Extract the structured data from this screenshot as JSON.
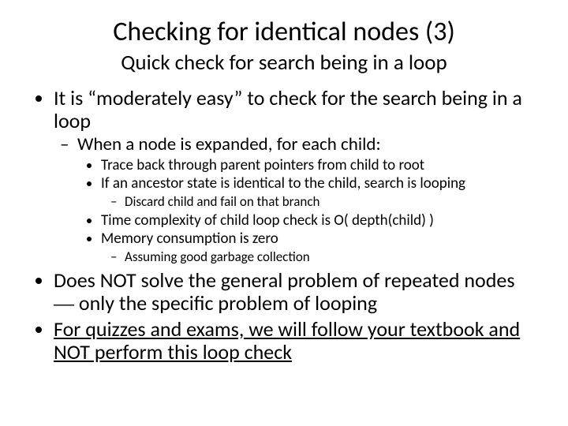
{
  "title": "Checking for identical nodes (3)",
  "subtitle": "Quick check for search being in a loop",
  "b1": "It is “moderately easy” to check for the search being in a loop",
  "b1a": "When a node is expanded, for each child:",
  "b1a_i": "Trace back through parent pointers from child to root",
  "b1a_ii": "If an ancestor state is identical to the child, search is looping",
  "b1a_ii_1": "Discard child and fail on that branch",
  "b1a_iii": "Time complexity of child loop check is O( depth(child) )",
  "b1a_iv": "Memory consumption is zero",
  "b1a_iv_1": "Assuming good garbage collection",
  "b2_pre": "Does NOT solve the general problem of repeated nodes ",
  "b2_dash": "—",
  "b2_post": " only the specific problem of looping",
  "b3": "For quizzes and exams, we will follow your textbook and NOT perform this loop check"
}
